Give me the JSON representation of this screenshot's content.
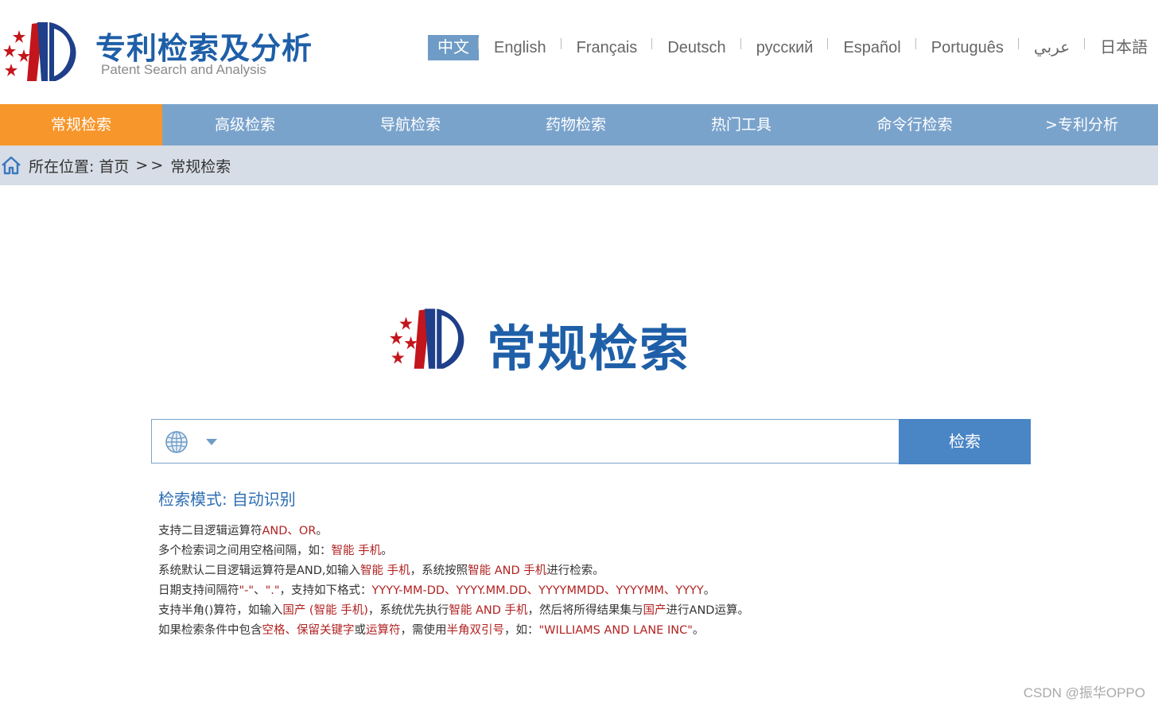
{
  "header": {
    "brand_title": "专利检索及分析",
    "brand_subtitle": "Patent Search and Analysis",
    "languages": [
      "中文",
      "English",
      "Français",
      "Deutsch",
      "русский",
      "Español",
      "Português",
      "عربي",
      "日本語"
    ],
    "active_language": "中文"
  },
  "nav": {
    "items": [
      "常规检索",
      "高级检索",
      "导航检索",
      "药物检索",
      "热门工具",
      "命令行检索",
      ">专利分析"
    ],
    "active": "常规检索"
  },
  "breadcrumb": {
    "label": "所在位置:",
    "home": "首页",
    "separator": ">>",
    "current": "常规检索"
  },
  "main": {
    "title": "常规检索",
    "search": {
      "value": "",
      "placeholder": "",
      "button_label": "检索"
    },
    "mode_label": "检索模式:",
    "mode_value": "自动识别"
  },
  "help": {
    "lines": [
      [
        {
          "t": "支持二目逻辑运算符"
        },
        {
          "t": "AND、OR",
          "h": true
        },
        {
          "t": "。"
        }
      ],
      [
        {
          "t": "多个检索词之间用空格间隔，如："
        },
        {
          "t": "智能 手机",
          "h": true
        },
        {
          "t": "。"
        }
      ],
      [
        {
          "t": "系统默认二目逻辑运算符是AND,如输入"
        },
        {
          "t": "智能 手机",
          "h": true
        },
        {
          "t": "，系统按照"
        },
        {
          "t": "智能 AND 手机",
          "h": true
        },
        {
          "t": "进行检索。"
        }
      ],
      [
        {
          "t": "日期支持间隔符"
        },
        {
          "t": "\"-\"",
          "h": true
        },
        {
          "t": "、"
        },
        {
          "t": "\".\"",
          "h": true
        },
        {
          "t": "，支持如下格式："
        },
        {
          "t": "YYYY-MM-DD、YYYY.MM.DD、YYYYMMDD、YYYYMM、YYYY",
          "h": true
        },
        {
          "t": "。"
        }
      ],
      [
        {
          "t": "支持半角()算符，如输入"
        },
        {
          "t": "国产 (智能 手机)",
          "h": true
        },
        {
          "t": "，系统优先执行"
        },
        {
          "t": "智能 AND 手机",
          "h": true
        },
        {
          "t": "，然后将所得结果集与"
        },
        {
          "t": "国产",
          "h": true
        },
        {
          "t": "进行AND运算。"
        }
      ],
      [
        {
          "t": "如果检索条件中包含"
        },
        {
          "t": "空格、保留关键字",
          "h": true
        },
        {
          "t": "或"
        },
        {
          "t": "运算符",
          "h": true
        },
        {
          "t": "，需使用"
        },
        {
          "t": "半角双引号",
          "h": true
        },
        {
          "t": "，如："
        },
        {
          "t": "\"WILLIAMS AND LANE INC\"",
          "h": true
        },
        {
          "t": "。"
        }
      ]
    ]
  },
  "watermark": "CSDN @振华OPPO",
  "colors": {
    "brand_blue": "#1f5fa8",
    "nav_blue": "#7aa3cc",
    "nav_active": "#f7962a",
    "button_blue": "#4a85c5",
    "highlight_red": "#b22222"
  }
}
